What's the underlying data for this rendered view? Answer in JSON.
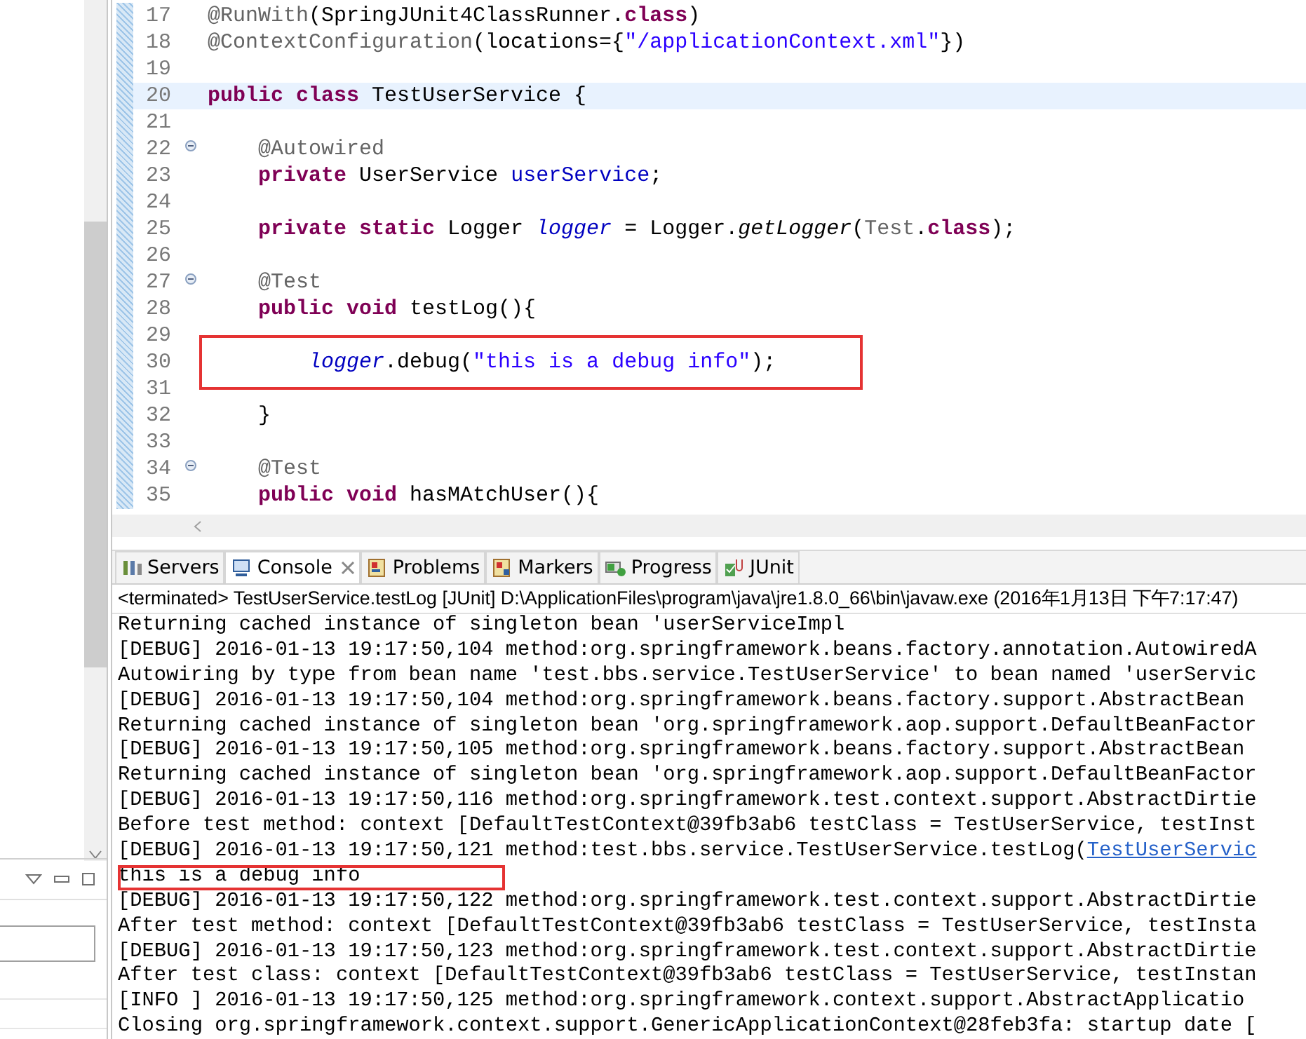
{
  "editor": {
    "lines": [
      {
        "number": "17",
        "tokens": [
          {
            "text": "@RunWith",
            "kind": "annotation"
          },
          {
            "text": "(SpringJUnit4ClassRunner.",
            "kind": "plain"
          },
          {
            "text": "class",
            "kind": "keyword"
          },
          {
            "text": ")",
            "kind": "plain"
          }
        ]
      },
      {
        "number": "18",
        "tokens": [
          {
            "text": "@ContextConfiguration",
            "kind": "annotation"
          },
          {
            "text": "(locations={",
            "kind": "plain"
          },
          {
            "text": "\"/applicationContext.xml\"",
            "kind": "string"
          },
          {
            "text": "})",
            "kind": "plain"
          }
        ]
      },
      {
        "number": "19"
      },
      {
        "number": "20",
        "current": true,
        "tokens": [
          {
            "text": "public class",
            "kind": "keyword"
          },
          {
            "text": " TestUserService {",
            "kind": "plain"
          }
        ]
      },
      {
        "number": "21"
      },
      {
        "number": "22",
        "fold": true,
        "tokens": [
          {
            "text": "    @Autowired",
            "kind": "annotation"
          }
        ]
      },
      {
        "number": "23",
        "tokens": [
          {
            "text": "    private",
            "kind": "keyword"
          },
          {
            "text": " UserService ",
            "kind": "plain"
          },
          {
            "text": "userService",
            "kind": "field"
          },
          {
            "text": ";",
            "kind": "plain"
          }
        ]
      },
      {
        "number": "24"
      },
      {
        "number": "25",
        "tokens": [
          {
            "text": "    private static",
            "kind": "keyword"
          },
          {
            "text": " Logger ",
            "kind": "plain"
          },
          {
            "text": "logger",
            "kind": "static-field"
          },
          {
            "text": " = Logger.",
            "kind": "plain"
          },
          {
            "text": "getLogger",
            "kind": "static-method"
          },
          {
            "text": "(",
            "kind": "plain"
          },
          {
            "text": "Test",
            "kind": "annotation"
          },
          {
            "text": ".",
            "kind": "plain"
          },
          {
            "text": "class",
            "kind": "keyword"
          },
          {
            "text": ");",
            "kind": "plain"
          }
        ]
      },
      {
        "number": "26"
      },
      {
        "number": "27",
        "fold": true,
        "tokens": [
          {
            "text": "    @Test",
            "kind": "annotation"
          }
        ]
      },
      {
        "number": "28",
        "tokens": [
          {
            "text": "    public void",
            "kind": "keyword"
          },
          {
            "text": " testLog(){",
            "kind": "plain"
          }
        ]
      },
      {
        "number": "29"
      },
      {
        "number": "30",
        "boxed": true,
        "tokens": [
          {
            "text": "        logger",
            "kind": "static-field"
          },
          {
            "text": ".debug(",
            "kind": "plain"
          },
          {
            "text": "\"this is a debug info\"",
            "kind": "string"
          },
          {
            "text": ");",
            "kind": "plain"
          }
        ]
      },
      {
        "number": "31"
      },
      {
        "number": "32",
        "tokens": [
          {
            "text": "    }",
            "kind": "plain"
          }
        ]
      },
      {
        "number": "33"
      },
      {
        "number": "34",
        "fold": true,
        "tokens": [
          {
            "text": "    @Test",
            "kind": "annotation"
          }
        ]
      },
      {
        "number": "35",
        "tokens": [
          {
            "text": "    public void",
            "kind": "keyword"
          },
          {
            "text": " hasMAtchUser(){",
            "kind": "plain"
          }
        ]
      }
    ]
  },
  "panel_tabs": [
    {
      "label": "Servers",
      "selected": false
    },
    {
      "label": "Console",
      "selected": true,
      "closable": true
    },
    {
      "label": "Problems",
      "selected": false
    },
    {
      "label": "Markers",
      "selected": false
    },
    {
      "label": "Progress",
      "selected": false
    },
    {
      "label": "JUnit",
      "selected": false
    }
  ],
  "console": {
    "header": "<terminated> TestUserService.testLog [JUnit] D:\\ApplicationFiles\\program\\java\\jre1.8.0_66\\bin\\javaw.exe (2016年1月13日 下午7:17:47)",
    "lines": [
      {
        "text": "Returning cached instance of singleton bean 'userServiceImpl"
      },
      {
        "text": "[DEBUG] 2016-01-13 19:17:50,104 method:org.springframework.beans.factory.annotation.AutowiredA"
      },
      {
        "text": "Autowiring by type from bean name 'test.bbs.service.TestUserService' to bean named 'userServic"
      },
      {
        "text": "[DEBUG] 2016-01-13 19:17:50,104 method:org.springframework.beans.factory.support.AbstractBean"
      },
      {
        "text": "Returning cached instance of singleton bean 'org.springframework.aop.support.DefaultBeanFactor"
      },
      {
        "text": "[DEBUG] 2016-01-13 19:17:50,105 method:org.springframework.beans.factory.support.AbstractBean"
      },
      {
        "text": "Returning cached instance of singleton bean 'org.springframework.aop.support.DefaultBeanFactor"
      },
      {
        "text": "[DEBUG] 2016-01-13 19:17:50,116 method:org.springframework.test.context.support.AbstractDirtie"
      },
      {
        "text": "Before test method: context [DefaultTestContext@39fb3ab6 testClass = TestUserService, testInst"
      },
      {
        "text": "[DEBUG] 2016-01-13 19:17:50,121 method:test.bbs.service.TestUserService.testLog(",
        "link": "TestUserServic"
      },
      {
        "text": "this is a debug info",
        "boxed": true
      },
      {
        "text": "[DEBUG] 2016-01-13 19:17:50,122 method:org.springframework.test.context.support.AbstractDirtie"
      },
      {
        "text": "After test method: context [DefaultTestContext@39fb3ab6 testClass = TestUserService, testInsta"
      },
      {
        "text": "[DEBUG] 2016-01-13 19:17:50,123 method:org.springframework.test.context.support.AbstractDirtie"
      },
      {
        "text": "After test class: context [DefaultTestContext@39fb3ab6 testClass = TestUserService, testInstan"
      },
      {
        "text": "[INFO ] 2016-01-13 19:17:50,125 method:org.springframework.context.support.AbstractApplicatio"
      },
      {
        "text": "Closing org.springframework.context.support.GenericApplicationContext@28feb3fa: startup date ["
      }
    ]
  }
}
